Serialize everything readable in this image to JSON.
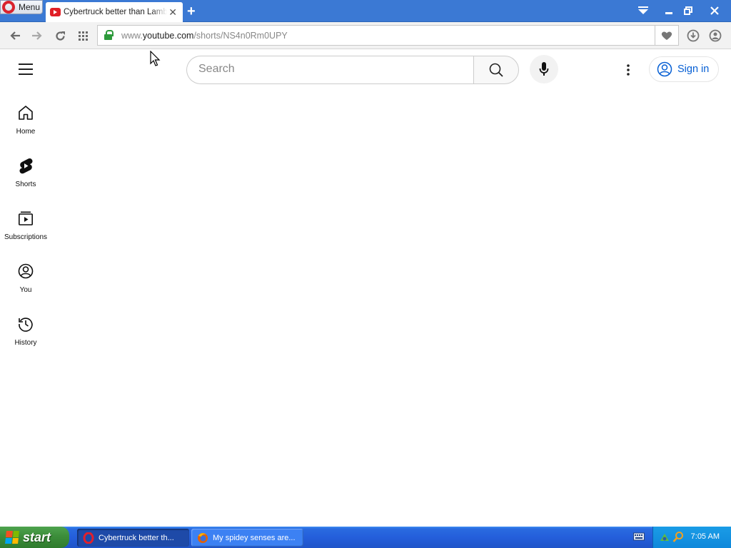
{
  "browser": {
    "menu_label": "Menu",
    "tab_title": "Cybertruck better than Lamborghini",
    "url_prefix": "www.",
    "url_domain": "youtube.com",
    "url_path": "/shorts/NS4n0Rm0UPY"
  },
  "youtube": {
    "search_placeholder": "Search",
    "signin_label": "Sign in",
    "guide": [
      {
        "label": "Home",
        "icon": "home-icon"
      },
      {
        "label": "Shorts",
        "icon": "shorts-icon"
      },
      {
        "label": "Subscriptions",
        "icon": "subscriptions-icon"
      },
      {
        "label": "You",
        "icon": "you-icon"
      },
      {
        "label": "History",
        "icon": "history-icon"
      }
    ]
  },
  "taskbar": {
    "start_label": "start",
    "tasks": [
      {
        "label": "Cybertruck better th...",
        "icon": "opera-icon",
        "active": true
      },
      {
        "label": "My spidey senses are...",
        "icon": "firefox-icon",
        "active": false
      }
    ],
    "clock": "7:05 AM"
  },
  "colors": {
    "titlebar": "#3b79d4",
    "youtube_blue": "#065fd4",
    "youtube_red": "#e01f26",
    "taskbar": "#245edb",
    "start_green": "#3c8d3a"
  }
}
